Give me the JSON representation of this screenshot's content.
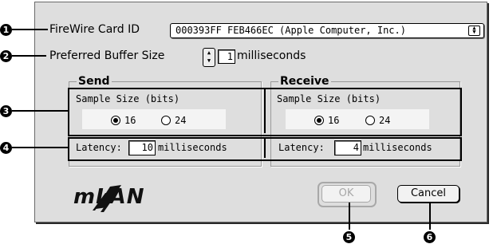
{
  "firewire": {
    "label": "FireWire Card ID",
    "selected": "000393FF FEB466EC (Apple Computer, Inc.)"
  },
  "buffer": {
    "label": "Preferred Buffer Size",
    "value": "1",
    "unit": "milliseconds"
  },
  "send": {
    "title": "Send",
    "sample_size_label": "Sample Size (bits)",
    "options": [
      "16",
      "24"
    ],
    "selected": "16",
    "latency_label": "Latency:",
    "latency_value": "10",
    "latency_unit": "milliseconds"
  },
  "receive": {
    "title": "Receive",
    "sample_size_label": "Sample Size (bits)",
    "options": [
      "16",
      "24"
    ],
    "selected": "16",
    "latency_label": "Latency:",
    "latency_value": "4",
    "latency_unit": "milliseconds"
  },
  "buttons": {
    "ok": "OK",
    "cancel": "Cancel"
  },
  "logo": {
    "text": "mLAN"
  },
  "callouts": [
    "1",
    "2",
    "3",
    "4",
    "5",
    "6"
  ],
  "icons": {
    "popup_arrows": "up-down-arrows-icon",
    "stepper": "up-down-stepper-icon"
  }
}
